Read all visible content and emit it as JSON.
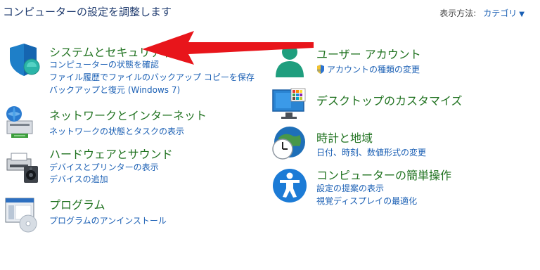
{
  "header": {
    "title": "コンピューターの設定を調整します",
    "view_by_label": "表示方法:",
    "view_by_value": "カテゴリ"
  },
  "left": [
    {
      "title": "システムとセキュリティ",
      "icon": "shield-icon",
      "links": [
        "コンピューターの状態を確認",
        "ファイル履歴でファイルのバックアップ コピーを保存",
        "バックアップと復元 (Windows 7)"
      ]
    },
    {
      "title": "ネットワークとインターネット",
      "icon": "network-globe-icon",
      "links": [
        "ネットワークの状態とタスクの表示"
      ]
    },
    {
      "title": "ハードウェアとサウンド",
      "icon": "printer-speaker-icon",
      "links": [
        "デバイスとプリンターの表示",
        "デバイスの追加"
      ]
    },
    {
      "title": "プログラム",
      "icon": "programs-disc-icon",
      "links": [
        "プログラムのアンインストール"
      ]
    }
  ],
  "right": [
    {
      "title": "ユーザー アカウント",
      "icon": "user-icon",
      "links": [
        "アカウントの種類の変更"
      ]
    },
    {
      "title": "デスクトップのカスタマイズ",
      "icon": "monitor-icon",
      "links": []
    },
    {
      "title": "時計と地域",
      "icon": "clock-globe-icon",
      "links": [
        "日付、時刻、数値形式の変更"
      ]
    },
    {
      "title": "コンピューターの簡単操作",
      "icon": "accessibility-icon",
      "links": [
        "設定の提案の表示",
        "視覚ディスプレイの最適化"
      ]
    }
  ],
  "colors": {
    "title_green": "#217321",
    "link_blue": "#1a5fb4",
    "arrow_red": "#e8151b"
  }
}
